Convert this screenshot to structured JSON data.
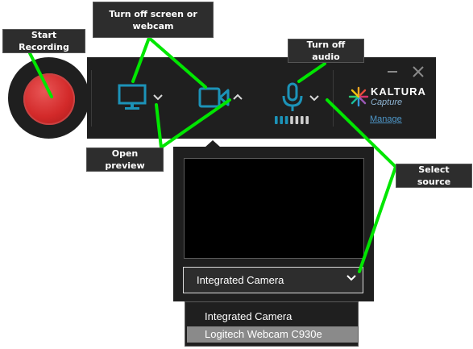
{
  "callouts": {
    "start_recording": "Start Recording",
    "turn_off_screen": "Turn off screen or webcam",
    "turn_off_audio": "Turn off audio",
    "open_preview": "Open preview",
    "select_source": "Select source"
  },
  "brand": {
    "name": "KALTURA",
    "product": "Capture",
    "manage_link": "Manage"
  },
  "source_select": {
    "selected": "Integrated Camera",
    "options": [
      "Integrated Camera",
      "Logitech Webcam C930e"
    ],
    "highlighted_index": 1
  },
  "audio_level": {
    "bars_total": 7,
    "bars_active": 3
  },
  "colors": {
    "accent": "#1c93b8",
    "callout_line": "#00e600",
    "record": "#d32a2a",
    "panel": "#1f1f1f",
    "manage_link": "#4e97c9"
  },
  "icons": [
    "record-icon",
    "monitor-icon",
    "webcam-icon",
    "microphone-icon",
    "chevron-down-icon",
    "chevron-up-icon",
    "minimize-icon",
    "close-icon",
    "kaltura-logo-icon"
  ]
}
